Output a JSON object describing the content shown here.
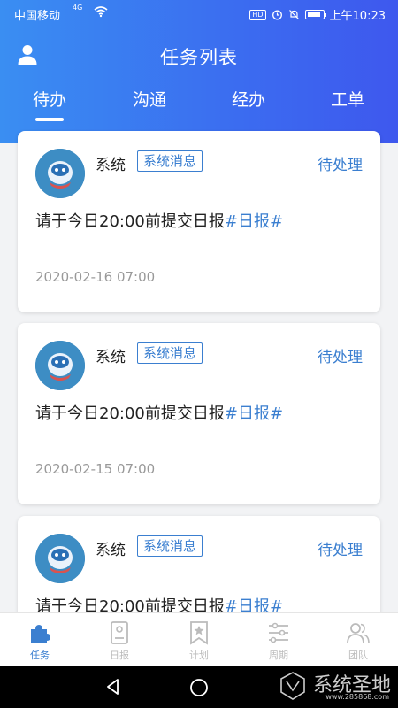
{
  "status_bar": {
    "carrier": "中国移动",
    "network": "4G",
    "hd": "HD",
    "time": "上午10:23"
  },
  "header": {
    "title": "任务列表",
    "tabs": [
      {
        "label": "待办",
        "active": true
      },
      {
        "label": "沟通",
        "active": false
      },
      {
        "label": "经办",
        "active": false
      },
      {
        "label": "工单",
        "active": false
      }
    ]
  },
  "tasks": [
    {
      "sender": "系统",
      "tag": "系统消息",
      "status": "待处理",
      "message": "请于今日20:00前提交日报",
      "hashtag": "#日报#",
      "date": "2020-02-16 07:00"
    },
    {
      "sender": "系统",
      "tag": "系统消息",
      "status": "待处理",
      "message": "请于今日20:00前提交日报",
      "hashtag": "#日报#",
      "date": "2020-02-15 07:00"
    },
    {
      "sender": "系统",
      "tag": "系统消息",
      "status": "待处理",
      "message": "请于今日20:00前提交日报",
      "hashtag": "#日报#",
      "date": ""
    }
  ],
  "bottom_nav": [
    {
      "label": "任务",
      "icon": "puzzle-icon",
      "active": true
    },
    {
      "label": "日报",
      "icon": "report-icon",
      "active": false
    },
    {
      "label": "计划",
      "icon": "bookmark-star-icon",
      "active": false
    },
    {
      "label": "周期",
      "icon": "sliders-icon",
      "active": false
    },
    {
      "label": "团队",
      "icon": "team-icon",
      "active": false
    }
  ],
  "watermark": {
    "main": "系统圣地",
    "sub": "www.285868.com"
  },
  "colors": {
    "accent": "#3b7fd0",
    "header_gradient_start": "#3a8ef2",
    "header_gradient_end": "#3e58ee"
  }
}
